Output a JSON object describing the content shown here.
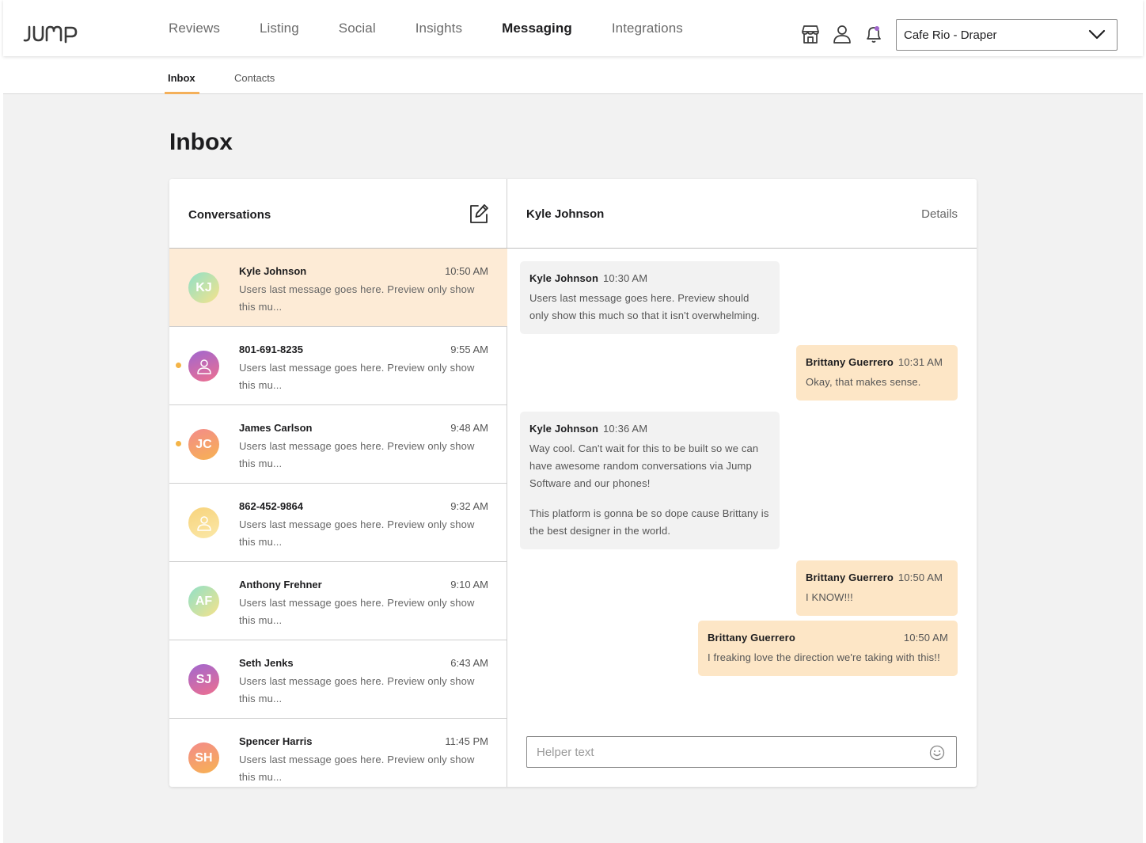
{
  "brand": {
    "logo_text": "JUMP",
    "accent_color": "#f4b05a",
    "selected_row_color": "#fdebd6",
    "outgoing_bubble_color": "#fde6c6"
  },
  "nav": {
    "items": [
      {
        "label": "Reviews",
        "active": false
      },
      {
        "label": "Listing",
        "active": false
      },
      {
        "label": "Social",
        "active": false
      },
      {
        "label": "Insights",
        "active": false
      },
      {
        "label": "Messaging",
        "active": true
      },
      {
        "label": "Integrations",
        "active": false
      }
    ],
    "icons": [
      "store-icon",
      "user-icon",
      "bell-icon"
    ],
    "location_select": {
      "value": "Cafe Rio - Draper",
      "icon": "chevron-down-icon"
    }
  },
  "subnav": {
    "tabs": [
      {
        "label": "Inbox",
        "active": true
      },
      {
        "label": "Contacts",
        "active": false
      }
    ]
  },
  "page": {
    "title": "Inbox"
  },
  "conversations": {
    "title": "Conversations",
    "compose_icon": "compose-icon",
    "items": [
      {
        "initials": "KJ",
        "name": "Kyle Johnson",
        "time": "10:50 AM",
        "preview": "Users last message goes here. Preview only show this mu...",
        "selected": true,
        "unread": false,
        "avatar": "initials",
        "gradient": "mint"
      },
      {
        "initials": "",
        "name": "801-691-8235",
        "time": "9:55 AM",
        "preview": "Users last message goes here. Preview only show this mu...",
        "selected": false,
        "unread": true,
        "avatar": "person-icon",
        "gradient": "purple"
      },
      {
        "initials": "JC",
        "name": "James Carlson",
        "time": "9:48 AM",
        "preview": "Users last message goes here. Preview only show this mu...",
        "selected": false,
        "unread": true,
        "avatar": "initials",
        "gradient": "orange"
      },
      {
        "initials": "",
        "name": "862-452-9864",
        "time": "9:32 AM",
        "preview": "Users last message goes here. Preview only show this mu...",
        "selected": false,
        "unread": false,
        "avatar": "person-icon",
        "gradient": "yellow"
      },
      {
        "initials": "AF",
        "name": "Anthony Frehner",
        "time": "9:10 AM",
        "preview": "Users last message goes here. Preview only show this mu...",
        "selected": false,
        "unread": false,
        "avatar": "initials",
        "gradient": "mint"
      },
      {
        "initials": "SJ",
        "name": "Seth Jenks",
        "time": "6:43 AM",
        "preview": "Users last message goes here. Preview only show this mu...",
        "selected": false,
        "unread": false,
        "avatar": "initials",
        "gradient": "purple"
      },
      {
        "initials": "SH",
        "name": "Spencer Harris",
        "time": "11:45 PM",
        "preview": "Users last message goes here. Preview only show this mu...",
        "selected": false,
        "unread": false,
        "avatar": "initials",
        "gradient": "orange"
      }
    ]
  },
  "chat": {
    "contact_name": "Kyle Johnson",
    "details_label": "Details",
    "messages": [
      {
        "direction": "in",
        "sender": "Kyle Johnson",
        "time": "10:30 AM",
        "paragraphs": [
          "Users last message goes here. Preview should only show this much so that it isn't overwhelming."
        ]
      },
      {
        "direction": "out",
        "sender": "Brittany Guerrero",
        "time": "10:31 AM",
        "paragraphs": [
          "Okay, that makes sense."
        ]
      },
      {
        "direction": "in",
        "sender": "Kyle Johnson",
        "time": "10:36 AM",
        "paragraphs": [
          "Way cool. Can't wait for this to be built so we can have awesome random conversations via Jump Software and our phones!",
          "This platform is gonna be so dope cause Brittany is the best designer in the world."
        ]
      },
      {
        "direction": "out",
        "sender": "Brittany Guerrero",
        "time": "10:50 AM",
        "paragraphs": [
          "I KNOW!!!"
        ]
      },
      {
        "direction": "out",
        "sender": "Brittany Guerrero",
        "time": "10:50 AM",
        "paragraphs": [
          "I freaking love the direction we're taking with this!!"
        ]
      }
    ],
    "composer": {
      "value": "",
      "placeholder": "Helper text",
      "icon": "emoji-icon"
    }
  }
}
